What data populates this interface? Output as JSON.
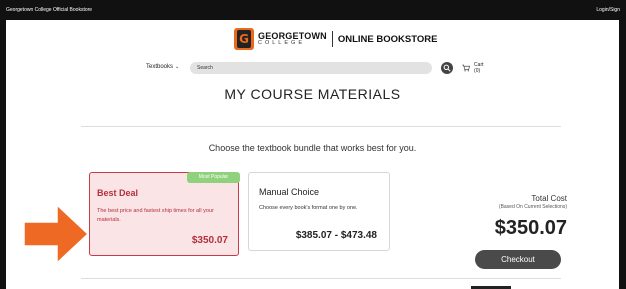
{
  "topbar": {
    "left_text": "Georgetown College Official Bookstore",
    "right_text": "Login/Sign"
  },
  "logo": {
    "college_name": "GEORGETOWN",
    "college_sub": "COLLEGE",
    "store_name": "ONLINE BOOKSTORE",
    "brand_color": "#e86a1a"
  },
  "nav": {
    "textbooks_label": "Textbooks",
    "search_placeholder": "Search",
    "cart_label": "Cart (0)"
  },
  "page_title": "MY COURSE MATERIALS",
  "subtitle": "Choose the textbook bundle that works best for you.",
  "options": {
    "best": {
      "badge": "Most Popular",
      "title": "Best Deal",
      "description": "The best price and fastest ship times for all your materials.",
      "price": "$350.07",
      "accent_color": "#c73c49"
    },
    "manual": {
      "title": "Manual Choice",
      "description": "Choose every book's format one by one.",
      "price": "$385.07 - $473.48"
    }
  },
  "total": {
    "label": "Total Cost",
    "sublabel": "(Based On Current Selections)",
    "value": "$350.07"
  },
  "checkout_label": "Checkout",
  "annotation": {
    "arrow_color": "#ee6a24",
    "icon": "right-arrow-icon"
  }
}
